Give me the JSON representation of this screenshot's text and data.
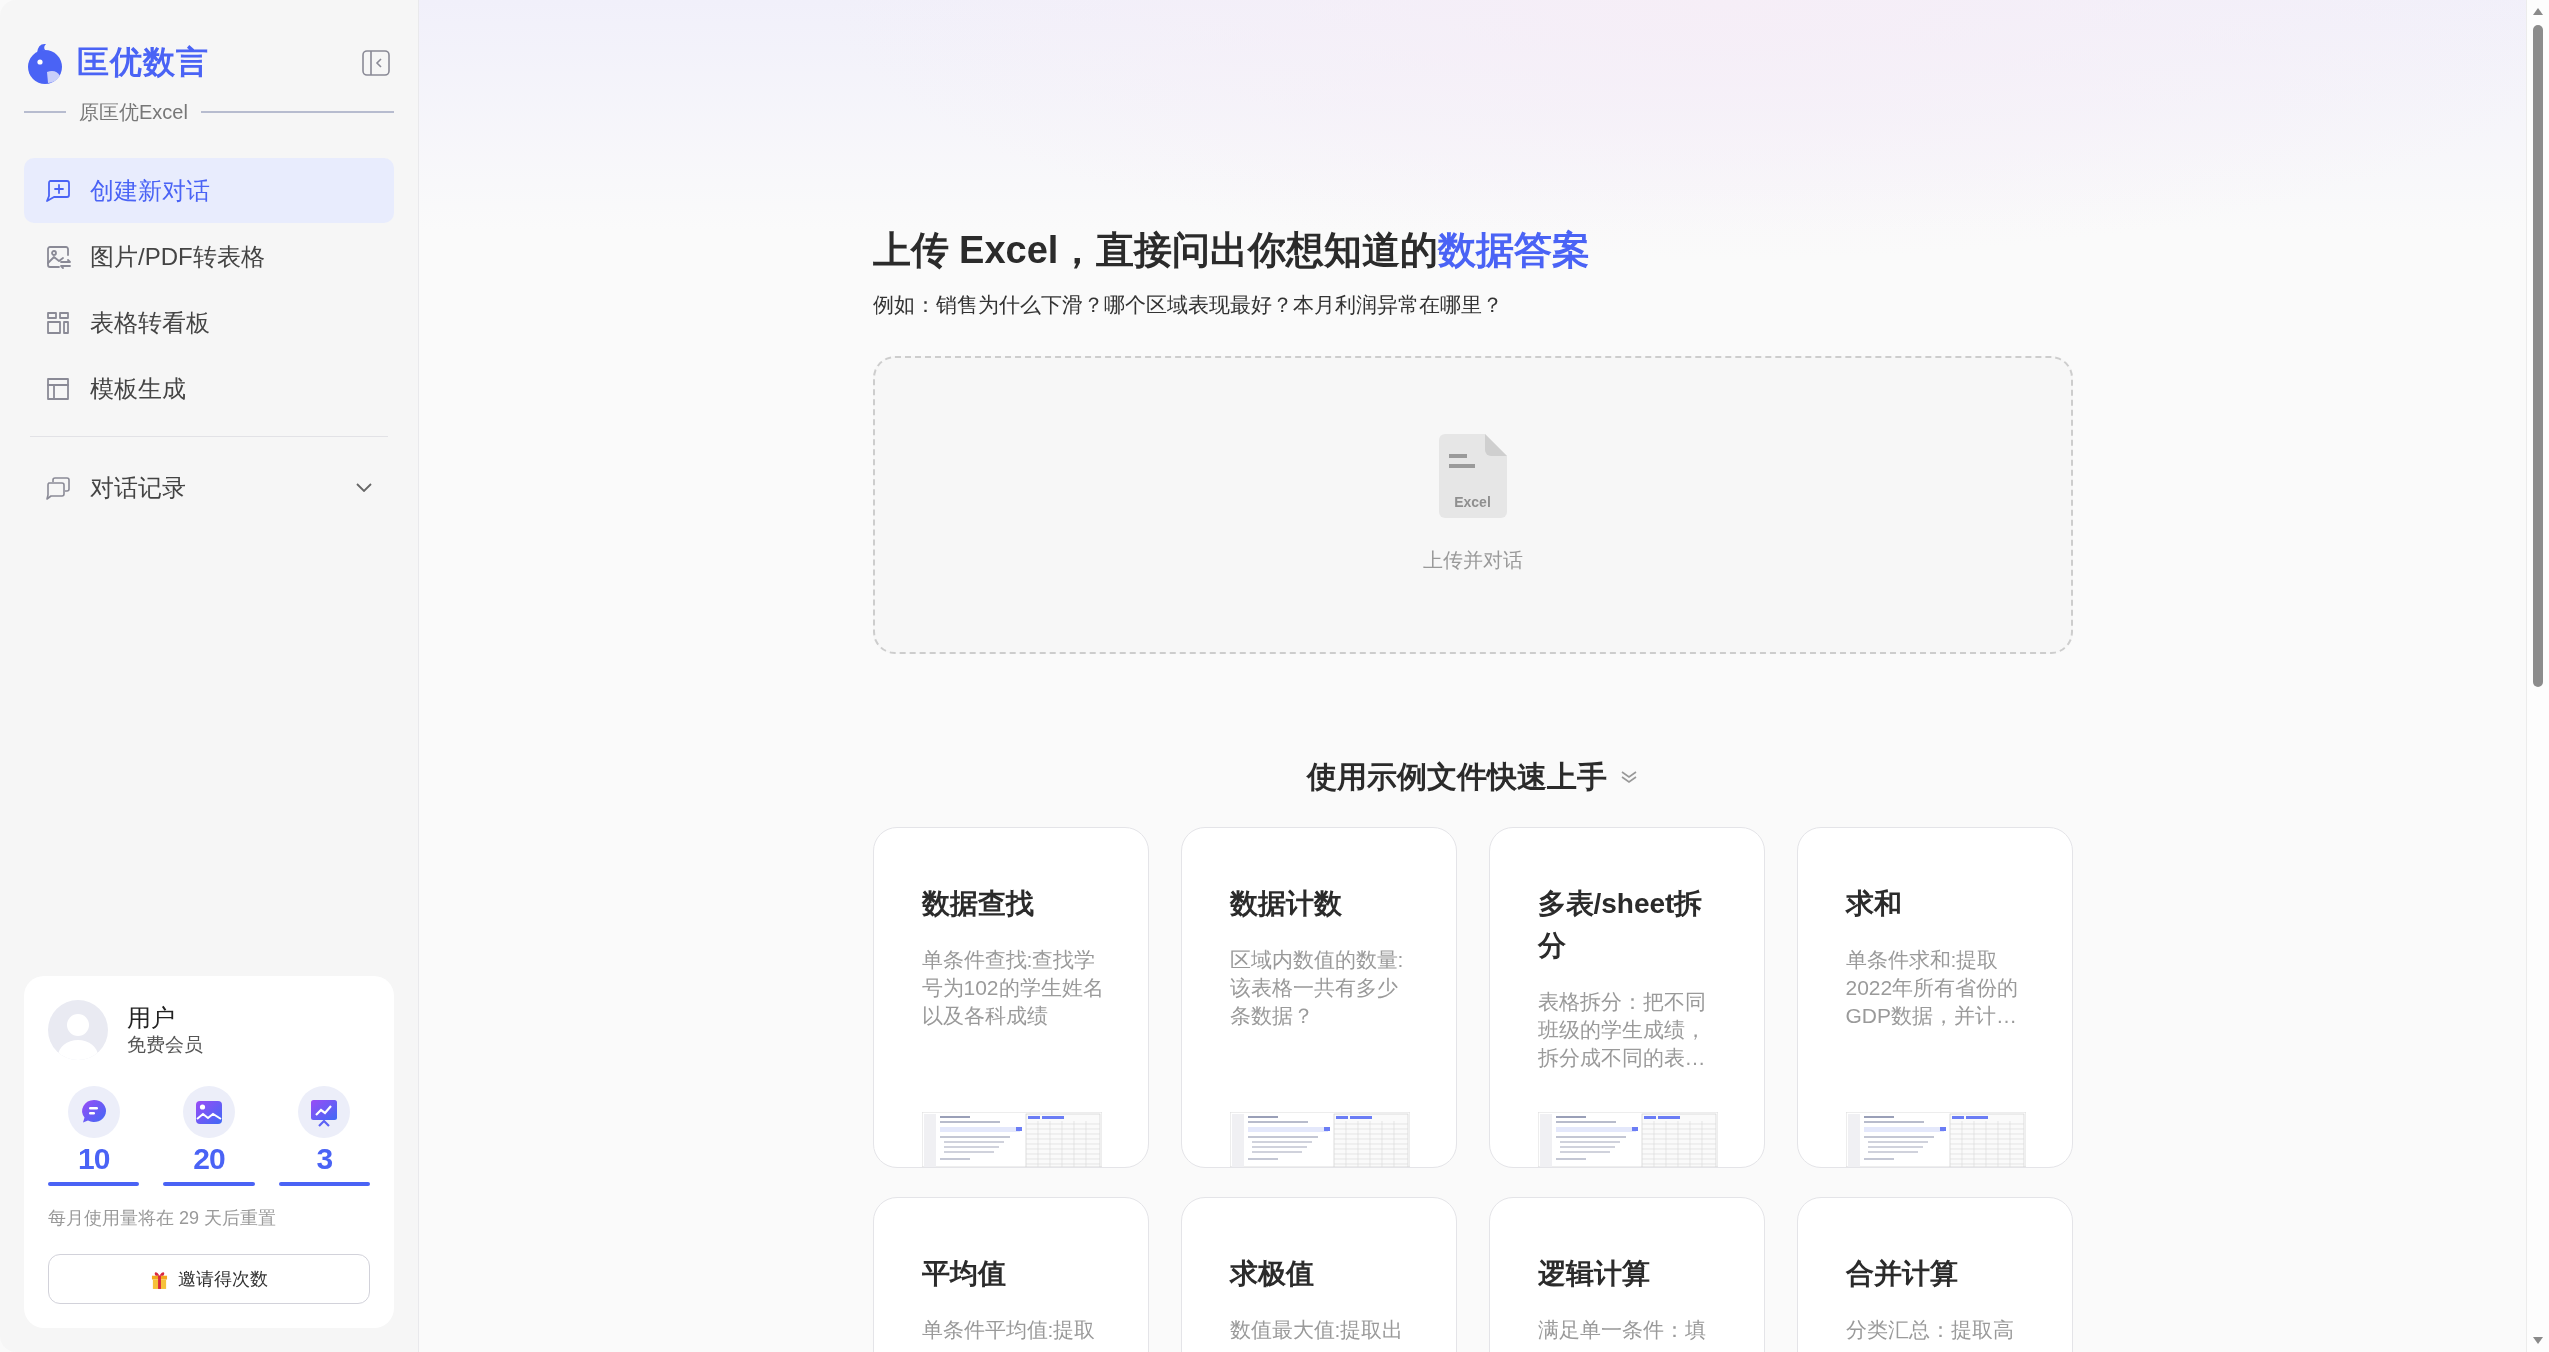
{
  "sidebar": {
    "brand": "匡优数言",
    "subtitle": "原匡优Excel",
    "nav": [
      {
        "kind": "new-chat",
        "label": "创建新对话",
        "selected": true
      },
      {
        "kind": "image-to-table",
        "label": "图片/PDF转表格",
        "selected": false
      },
      {
        "kind": "dashboard",
        "label": "表格转看板",
        "selected": false
      },
      {
        "kind": "template",
        "label": "模板生成",
        "selected": false
      }
    ],
    "history": {
      "label": "对话记录",
      "expanded": false
    },
    "user": {
      "name": "用户",
      "plan": "免费会员",
      "stats": [
        {
          "kind": "chat",
          "value": "10"
        },
        {
          "kind": "image",
          "value": "20"
        },
        {
          "kind": "chart",
          "value": "3"
        }
      ],
      "reset_note": "每月使用量将在 29 天后重置",
      "invite_button": "邀请得次数"
    }
  },
  "main": {
    "heading": {
      "text": "上传 Excel，直接问出你想知道的",
      "highlight": "数据答案"
    },
    "example": "例如：销售为什么下滑？哪个区域表现最好？本月利润异常在哪里？",
    "upload": {
      "file_type": "Excel",
      "label": "上传并对话"
    },
    "samples": {
      "title": "使用示例文件快速上手",
      "cards": [
        {
          "title": "数据查找",
          "description": "单条件查找:查找学号为102的学生姓名以及各科成绩",
          "preview": true
        },
        {
          "title": "数据计数",
          "description": "区域内数值的数量:该表格一共有多少条数据？",
          "preview": true
        },
        {
          "title": "多表/sheet拆分",
          "description": "表格拆分：把不同班级的学生成绩，拆分成不同的表…",
          "preview": true
        },
        {
          "title": "求和",
          "description": "单条件求和:提取2022年所有省份的GDP数据，并计…",
          "preview": true
        },
        {
          "title": "平均值",
          "description": "单条件平均值:提取"
        },
        {
          "title": "求极值",
          "description": "数值最大值:提取出"
        },
        {
          "title": "逻辑计算",
          "description": "满足单一条件：填"
        },
        {
          "title": "合并计算",
          "description": "分类汇总：提取高"
        }
      ]
    }
  }
}
